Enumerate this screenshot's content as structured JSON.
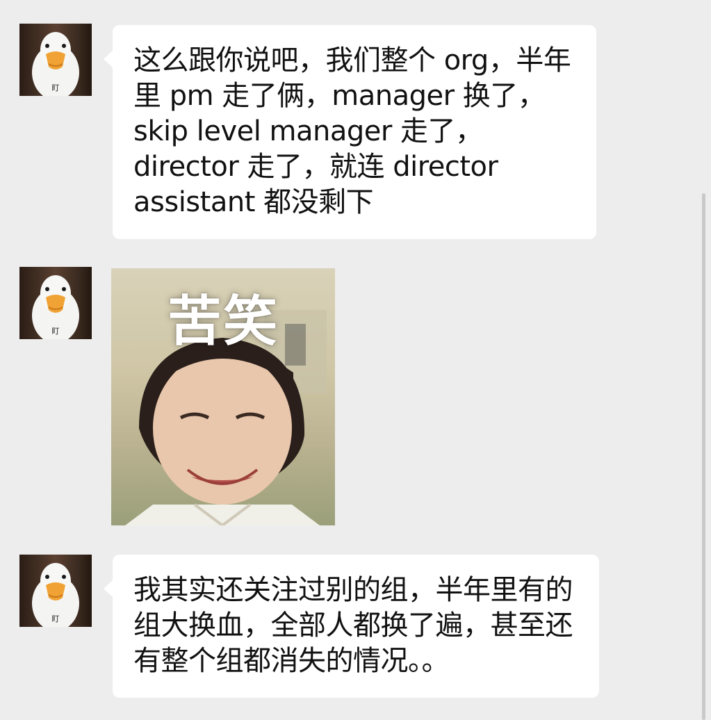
{
  "messages": [
    {
      "avatar_label": "盯",
      "text": "这么跟你说吧，我们整个 org，半年里 pm 走了俩，manager 换了，skip level manager 走了，director 走了，就连 director assistant 都没剩下"
    },
    {
      "avatar_label": "盯",
      "sticker_caption": "苦笑"
    },
    {
      "avatar_label": "盯",
      "text": "我其实还关注过别的组，半年里有的组大换血，全部人都换了遍，甚至还有整个组都消失的情况。。"
    }
  ],
  "icons": {
    "avatar": "duck-avatar-icon"
  },
  "colors": {
    "background": "#ededed",
    "bubble": "#ffffff",
    "text": "#111111"
  }
}
